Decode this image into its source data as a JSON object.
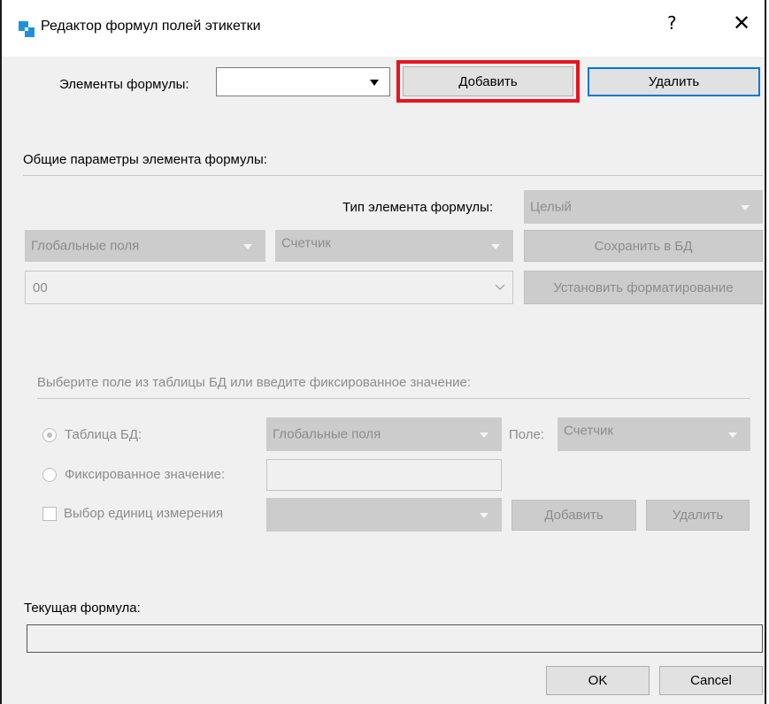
{
  "window": {
    "title": "Редактор формул полей этикетки",
    "help": "?",
    "close": "✕"
  },
  "formula_elements": {
    "label": "Элементы формулы:",
    "value": "",
    "add_label": "Добавить",
    "delete_label": "Удалить"
  },
  "general": {
    "header": "Общие параметры элемента формулы:",
    "type_label": "Тип элемента формулы:",
    "type_value": "Целый",
    "table_value": "Глобальные поля",
    "field_value": "Счетчик",
    "save_label": "Сохранить в БД",
    "format_value": "00",
    "set_format_label": "Установить форматирование"
  },
  "select_section": {
    "header": "Выберите поле из таблицы БД или введите фиксированное значение:",
    "table_radio_label": "Таблица БД:",
    "table_value": "Глобальные поля",
    "field_label": "Поле:",
    "field_value": "Счетчик",
    "fixed_radio_label": "Фиксированное значение:",
    "fixed_value": "",
    "units_label": "Выбор единиц измерения",
    "units_value": "",
    "add_label": "Добавить",
    "delete_label": "Удалить"
  },
  "current_formula": {
    "label": "Текущая формула:",
    "value": ""
  },
  "footer": {
    "ok_label": "OK",
    "cancel_label": "Cancel"
  },
  "colors": {
    "highlight": "#e8141c",
    "focus": "#0078d7"
  },
  "icons": [
    "app-icon",
    "help-icon",
    "close-icon",
    "chevron-down-icon"
  ]
}
